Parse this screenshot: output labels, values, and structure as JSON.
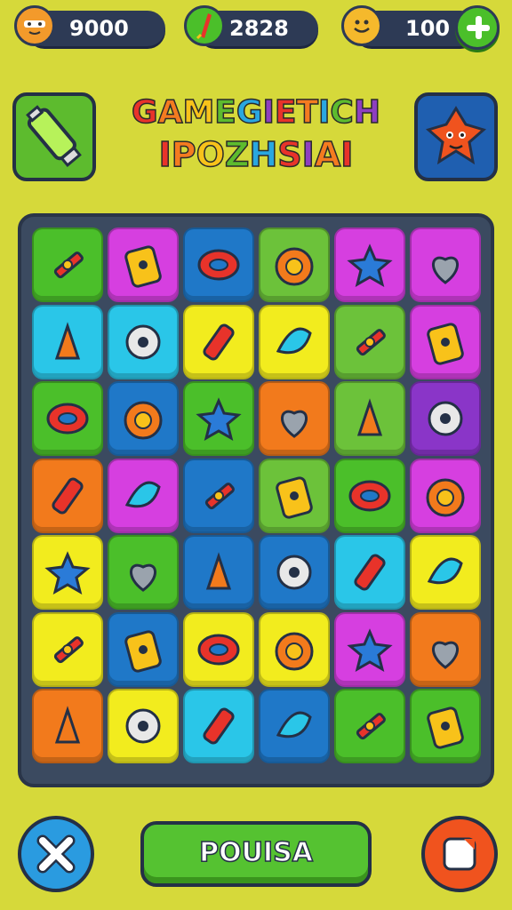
{
  "currencies": [
    {
      "value": "9000",
      "icon": "face-coin-icon",
      "color": "#f39a2b"
    },
    {
      "value": "2828",
      "icon": "feather-gem-icon",
      "color": "#4bbf2a"
    },
    {
      "value": "100",
      "icon": "smiley-coin-icon",
      "color": "#f5b92c"
    }
  ],
  "title": {
    "line1": [
      "G",
      "A",
      "M",
      "E",
      "G",
      "I",
      "E",
      "T",
      "I",
      "C",
      "H"
    ],
    "line2": [
      "I",
      "P",
      "O",
      "Z",
      "H",
      "S",
      "I",
      "A",
      "I"
    ],
    "line1_colors": [
      "#e8332a",
      "#f47b20",
      "#f8c21a",
      "#5dbb2e",
      "#2aa7e0",
      "#8e3fbf",
      "#e8332a",
      "#f47b20",
      "#2aa7e0",
      "#5dbb2e",
      "#8e3fbf"
    ],
    "line2_colors": [
      "#e8332a",
      "#f47b20",
      "#f8c21a",
      "#5dbb2e",
      "#2aa7e0",
      "#e8332a",
      "#8e3fbf",
      "#f47b20",
      "#e8332a"
    ]
  },
  "left_corner": {
    "icon": "battery-tube-icon",
    "color": "#5dbb2e"
  },
  "right_corner": {
    "icon": "star-monster-icon",
    "color": "#1f5fb0"
  },
  "board": {
    "rows": [
      [
        [
          "#4bbf2a",
          "wrench-tools-icon"
        ],
        [
          "#d63fe0",
          "card-icon"
        ],
        [
          "#1f78c8",
          "tape-roll-icon"
        ],
        [
          "#6cc23a",
          "basket-icon"
        ],
        [
          "#d63fe0",
          "leaf-pen-icon"
        ],
        [
          "#d63fe0",
          "bag-icon"
        ]
      ],
      [
        [
          "#2ac6e8",
          "rocket-icon"
        ],
        [
          "#2ac6e8",
          "cross-tools-icon"
        ],
        [
          "#f2ec1e",
          "blue-star-icon"
        ],
        [
          "#f2ec1e",
          "flower-wand-icon"
        ],
        [
          "#6cc23a",
          "orange-leaf-icon"
        ],
        [
          "#d63fe0",
          "brush-icon"
        ]
      ],
      [
        [
          "#4bbf2a",
          "sun-gear-icon"
        ],
        [
          "#1f78c8",
          "yellow-bird-icon"
        ],
        [
          "#4bbf2a",
          "orange-sun-icon"
        ],
        [
          "#f27a1c",
          "pink-balloon-icon"
        ],
        [
          "#6cc23a",
          "paper-plane-icon"
        ],
        [
          "#8a35c8",
          "star-outline-icon"
        ]
      ],
      [
        [
          "#f27a1c",
          "marker-icon"
        ],
        [
          "#d63fe0",
          "gear-icon"
        ],
        [
          "#1f78c8",
          "salt-shaker-icon"
        ],
        [
          "#6cc23a",
          "berries-icon"
        ],
        [
          "#4bbf2a",
          "gift-box-icon"
        ],
        [
          "#d63fe0",
          "ghost-icon"
        ]
      ],
      [
        [
          "#f2ec1e",
          "heart-icon"
        ],
        [
          "#4bbf2a",
          "orange-gear-icon"
        ],
        [
          "#1f78c8",
          "fuel-can-icon"
        ],
        [
          "#1f78c8",
          "paint-brush-icon"
        ],
        [
          "#2ac6e8",
          "clock-icon"
        ],
        [
          "#f2ec1e",
          "cone-icon"
        ]
      ],
      [
        [
          "#f2ec1e",
          "pin-wand-icon"
        ],
        [
          "#1f78c8",
          "ring-icon"
        ],
        [
          "#f2ec1e",
          "swirl-icon"
        ],
        [
          "#f2ec1e",
          "donut-icon"
        ],
        [
          "#d63fe0",
          "dice-icon"
        ],
        [
          "#f27a1c",
          "clipboard-icon"
        ]
      ],
      [
        [
          "#f27a1c",
          "pink-gear-icon"
        ],
        [
          "#f2ec1e",
          "ball-icon"
        ],
        [
          "#2ac6e8",
          "lipstick-icon"
        ],
        [
          "#1f78c8",
          "bottle-icon"
        ],
        [
          "#4bbf2a",
          "pencil-cup-icon"
        ],
        [
          "#4bbf2a",
          "teal-leaf-icon"
        ]
      ]
    ]
  },
  "bottom": {
    "close": {
      "icon": "close-icon",
      "color": "#2a9be0"
    },
    "play_label": "POUISA",
    "stop": {
      "icon": "stop-icon",
      "color": "#f0531e"
    }
  }
}
